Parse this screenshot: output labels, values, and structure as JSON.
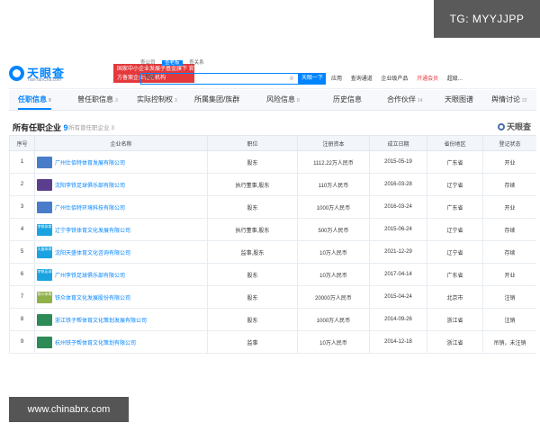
{
  "overlays": {
    "tg": "TG: MYYJJPP",
    "site": "www.chinabrx.com"
  },
  "header": {
    "logo_name": "天眼查",
    "logo_url": "TianYanCha.com",
    "badge": "国家中小企业发展子基金旗下 官方备案企业征信机构",
    "search_tabs": [
      "查公司",
      "查老板",
      "查关系"
    ],
    "active_search_tab": "查老板",
    "search_value": "李铁",
    "search_button": "天眼一下",
    "nav": [
      "应用",
      "查询通道",
      "企业级产品",
      "开通会员",
      "超级..."
    ]
  },
  "tabs": [
    {
      "label": "任职信息",
      "count": "9"
    },
    {
      "label": "曾任职信息",
      "count": "3"
    },
    {
      "label": "实际控制权",
      "count": "3"
    },
    {
      "label": "所属集团/族群",
      "count": ""
    },
    {
      "label": "风险信息",
      "count": "8"
    },
    {
      "label": "历史信息",
      "count": ""
    },
    {
      "label": "合作伙伴",
      "count": "14"
    },
    {
      "label": "天眼图谱",
      "count": ""
    },
    {
      "label": "舆情讨论",
      "count": "22"
    }
  ],
  "section": {
    "title": "所有任职企业",
    "count": "9",
    "sub_label": "所有曾任职企业",
    "sub_count": "3",
    "watermark": "天眼查"
  },
  "table": {
    "headers": [
      "序号",
      "企业名称",
      "职位",
      "注册资本",
      "成立日期",
      "省份地区",
      "登记状态"
    ],
    "rows": [
      {
        "no": "1",
        "icon": "",
        "name": "广州仕佰特体育发展有限公司",
        "role": "股东",
        "capital": "1112.22万人民币",
        "date": "2015-05-19",
        "region": "广东省",
        "status": "开业"
      },
      {
        "no": "2",
        "icon": "",
        "name": "沈阳李铁足球俱乐部有限公司",
        "role": "执行董事,股东",
        "capital": "110万人民币",
        "date": "2016-03-28",
        "region": "辽宁省",
        "status": "存续"
      },
      {
        "no": "3",
        "icon": "",
        "name": "广州仕佰特环境科技有限公司",
        "role": "股东",
        "capital": "1000万人民币",
        "date": "2016-03-24",
        "region": "广东省",
        "status": "开业"
      },
      {
        "no": "4",
        "icon": "李铁体育",
        "name": "辽宁李铁体育文化发展有限公司",
        "role": "执行董事,股东",
        "capital": "500万人民币",
        "date": "2015-06-24",
        "region": "辽宁省",
        "status": "存续"
      },
      {
        "no": "5",
        "icon": "天盛体育",
        "name": "沈阳天盛体育文化咨询有限公司",
        "role": "监事,股东",
        "capital": "10万人民币",
        "date": "2021-12-29",
        "region": "辽宁省",
        "status": "存续"
      },
      {
        "no": "6",
        "icon": "李铁足球",
        "name": "广州李铁足球俱乐部有限公司",
        "role": "股东",
        "capital": "10万人民币",
        "date": "2017-04-14",
        "region": "广东省",
        "status": "开业"
      },
      {
        "no": "7",
        "icon": "铁众体育",
        "name": "铁众体育文化发展股份有限公司",
        "role": "股东",
        "capital": "20000万人民币",
        "date": "2015-04-24",
        "region": "北京市",
        "status": "注销"
      },
      {
        "no": "8",
        "icon": "",
        "name": "浙江铁子帮体育文化策划发展有限公司",
        "role": "股东",
        "capital": "1000万人民币",
        "date": "2014-09-26",
        "region": "浙江省",
        "status": "注销"
      },
      {
        "no": "9",
        "icon": "",
        "name": "杭州铁子帮体育文化策划有限公司",
        "role": "监事",
        "capital": "10万人民币",
        "date": "2014-12-18",
        "region": "浙江省",
        "status": "吊销，未注销"
      }
    ]
  },
  "colors": {
    "brand": "#0084ff",
    "ok": "#36a23a",
    "warn": "#f08a24",
    "bad": "#e4393c"
  }
}
